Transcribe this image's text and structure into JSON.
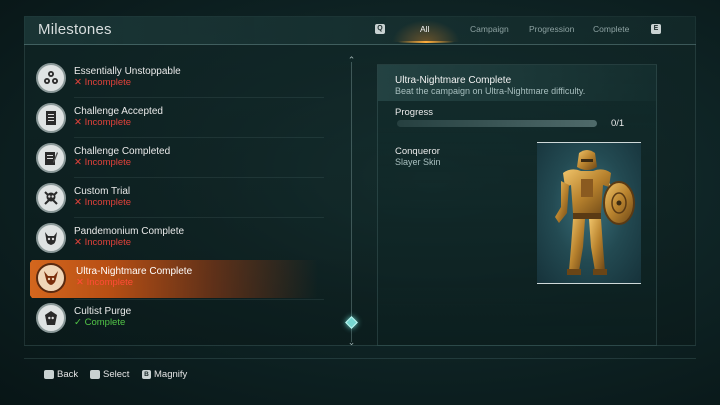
{
  "header": {
    "title": "Milestones",
    "left_key": "Q",
    "right_key": "E",
    "tabs": [
      {
        "label": "All",
        "active": true
      },
      {
        "label": "Campaign",
        "active": false
      },
      {
        "label": "Progression",
        "active": false
      },
      {
        "label": "Complete",
        "active": false
      }
    ]
  },
  "milestones": [
    {
      "name": "Essentially Unstoppable",
      "status": "Incomplete",
      "state": "incomplete",
      "icon": "runes-emblem-icon"
    },
    {
      "name": "Challenge Accepted",
      "status": "Incomplete",
      "state": "incomplete",
      "icon": "checklist-icon"
    },
    {
      "name": "Challenge Completed",
      "status": "Incomplete",
      "state": "incomplete",
      "icon": "quill-document-icon"
    },
    {
      "name": "Custom Trial",
      "status": "Incomplete",
      "state": "incomplete",
      "icon": "skull-crossbones-icon"
    },
    {
      "name": "Pandemonium Complete",
      "status": "Incomplete",
      "state": "incomplete",
      "icon": "demon-skull-icon"
    },
    {
      "name": "Ultra-Nightmare Complete",
      "status": "Incomplete",
      "state": "incomplete",
      "icon": "horned-demon-icon",
      "selected": true
    },
    {
      "name": "Cultist Purge",
      "status": "Complete",
      "state": "complete",
      "icon": "cultist-skull-icon"
    }
  ],
  "status_icons": {
    "incomplete": "x-mark-icon",
    "complete": "check-mark-icon"
  },
  "detail": {
    "title": "Ultra-Nightmare Complete",
    "description": "Beat the campaign on Ultra-Nightmare difficulty.",
    "progress_label": "Progress",
    "progress_value": "0/1",
    "progress_fraction": 0,
    "reward_name": "Conqueror",
    "reward_type": "Slayer Skin",
    "reward_icon": "golden-slayer-armor-with-shield"
  },
  "footer": {
    "hints": [
      {
        "key": "Esc",
        "label": "Back"
      },
      {
        "key": "Enter",
        "label": "Select"
      },
      {
        "key": "B",
        "label": "Magnify"
      }
    ]
  },
  "colors": {
    "accent_orange": "#d86a1f",
    "incomplete_red": "#e0413a",
    "complete_green": "#52c447",
    "scroll_thumb_teal": "#77d6d0"
  }
}
